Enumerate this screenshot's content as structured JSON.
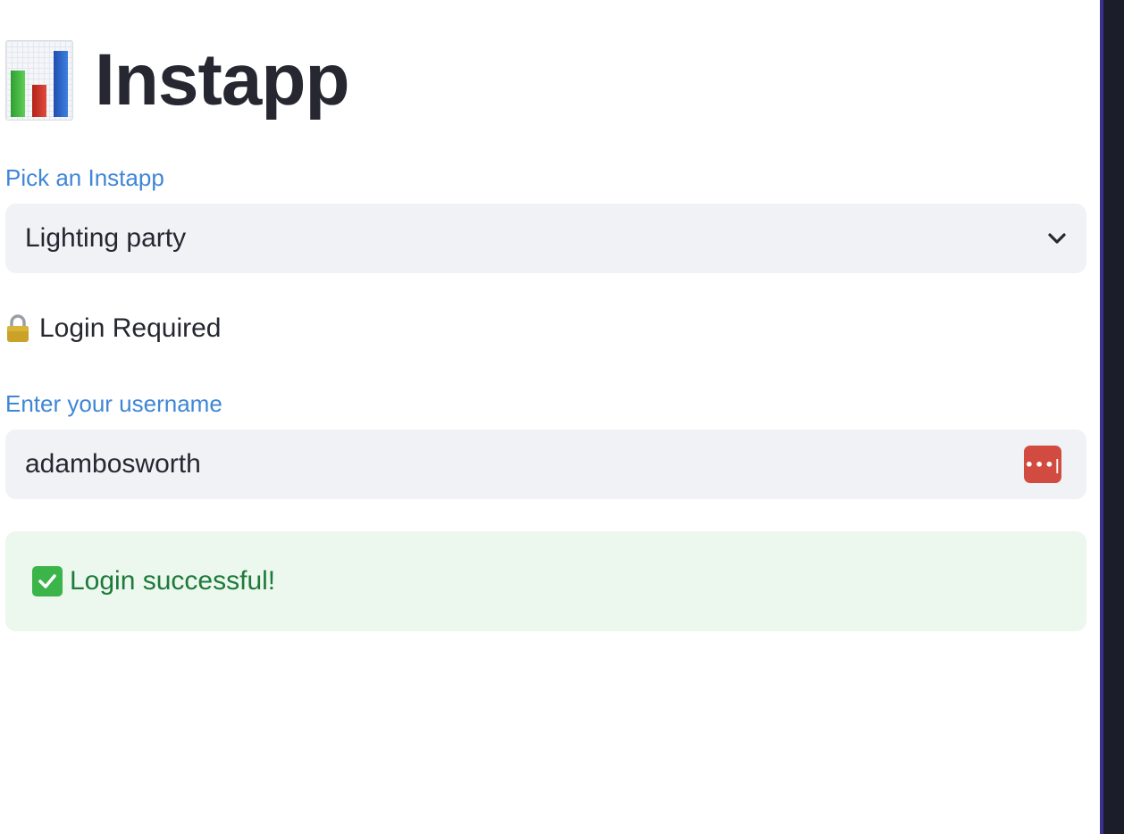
{
  "app": {
    "title": "Instapp",
    "title_icon": "bar-chart-icon"
  },
  "picker": {
    "label": "Pick an Instapp",
    "selected": "Lighting party",
    "icon": "chevron-down-icon"
  },
  "login_section": {
    "heading": "Login Required",
    "icon": "lock-icon"
  },
  "username": {
    "label": "Enter your username",
    "value": "adambosworth",
    "icon": "password-manager-icon",
    "icon_text": "•••|"
  },
  "status": {
    "message": "Login successful!",
    "icon": "check-icon",
    "color": "#1d7a3a",
    "background": "#ecf7ee"
  },
  "colors": {
    "label": "#3f86d6",
    "input_bg": "#f0f2f6",
    "text": "#262730"
  }
}
